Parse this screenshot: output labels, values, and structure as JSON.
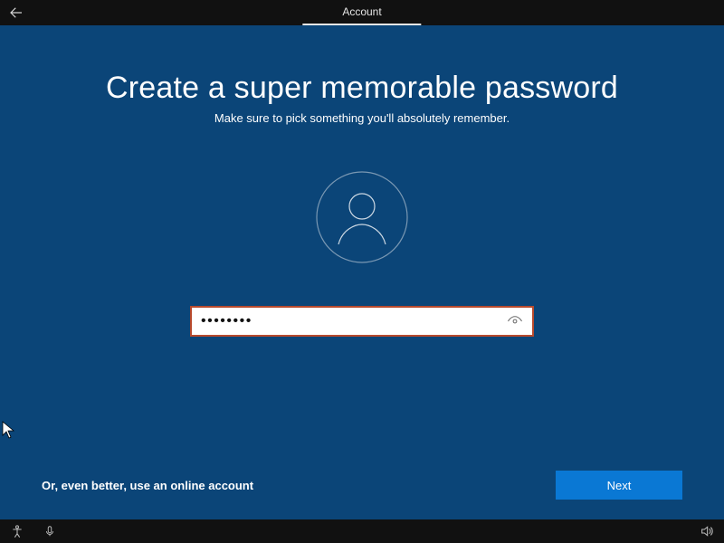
{
  "topbar": {
    "title": "Account"
  },
  "main": {
    "headline": "Create a super memorable password",
    "subhead": "Make sure to pick something you'll absolutely remember.",
    "password_mask": "••••••••"
  },
  "footer": {
    "alt_link": "Or, even better, use an online account",
    "next_label": "Next"
  },
  "colors": {
    "pane_bg": "#0b4578",
    "field_border": "#b84a2d",
    "next_btn_bg": "#0a78d4"
  }
}
